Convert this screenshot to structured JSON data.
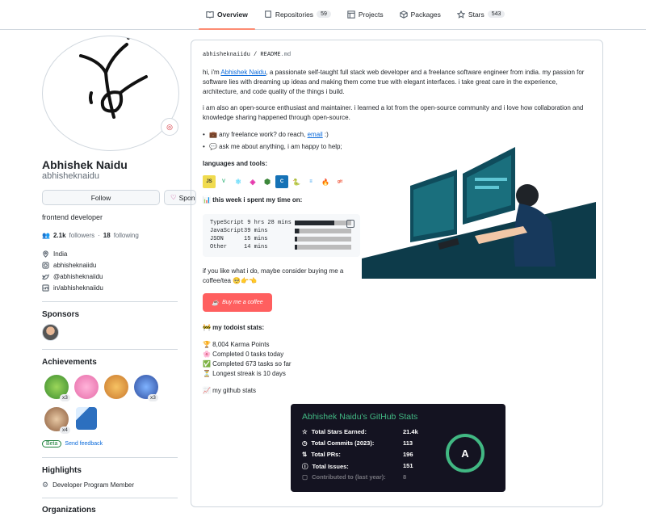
{
  "nav": {
    "tabs": [
      {
        "label": "Overview",
        "icon": "book-icon"
      },
      {
        "label": "Repositories",
        "icon": "repo-icon",
        "count": "59"
      },
      {
        "label": "Projects",
        "icon": "table-icon"
      },
      {
        "label": "Packages",
        "icon": "package-icon"
      },
      {
        "label": "Stars",
        "icon": "star-icon",
        "count": "543"
      }
    ]
  },
  "profile": {
    "name": "Abhishek Naidu",
    "login": "abhisheknaidu",
    "follow_label": "Follow",
    "sponsor_label": "Sponsor",
    "bio": "frontend developer",
    "followers_count": "2.1k",
    "followers_label": "followers",
    "following_count": "18",
    "following_label": "following",
    "location": "India",
    "instagram": "abhisheknaiidu",
    "twitter": "@abhisheknaiidu",
    "linkedin": "in/abhisheknaiidu"
  },
  "sidebar": {
    "sponsors_heading": "Sponsors",
    "achievements_heading": "Achievements",
    "achievements": [
      {
        "name": "pair-extraordinaire",
        "count": "x3"
      },
      {
        "name": "yolo",
        "count": ""
      },
      {
        "name": "starstruck",
        "count": ""
      },
      {
        "name": "pull-shark",
        "count": "x3"
      },
      {
        "name": "galaxy-brain",
        "count": "x4"
      },
      {
        "name": "arctic-code-vault",
        "count": ""
      }
    ],
    "beta_label": "Beta",
    "feedback_label": "Send feedback",
    "highlights_heading": "Highlights",
    "highlight_item": "Developer Program Member",
    "organizations_heading": "Organizations"
  },
  "readme": {
    "path_user": "abhisheknaiidu",
    "path_sep": "/",
    "path_file": "README",
    "path_ext": ".md",
    "intro_prefix": "hi, i'm ",
    "intro_link": "Abhishek Naidu",
    "intro_suffix": ", a passionate self-taught full stack web developer and a freelance software engineer from india. my passion for software lies with dreaming up ideas and making them come true with elegant interfaces. i take great care in the experience, architecture, and code quality of the things i build.",
    "para2": "i am also an open-source enthusiast and maintainer. i learned a lot from the open-source community and i love how collaboration and knowledge sharing happened through open-source.",
    "bullet1_prefix": "💼 any freelance work? do reach, ",
    "bullet1_link": "email",
    "bullet1_suffix": " :)",
    "bullet2": "💬 ask me about anything, i am happy to help;",
    "languages_heading": "languages and tools:",
    "tools": [
      "JS",
      "V",
      "⚛",
      "◈",
      "⬢",
      "C",
      "🐍",
      "≡",
      "🔥",
      "git"
    ],
    "week_heading": "📊 this week i spent my time on:",
    "time_rows": [
      {
        "lang": "TypeScript",
        "time": " 9 hrs 28 mins",
        "pct": 70
      },
      {
        "lang": "JavaScript",
        "time": "39 mins       ",
        "pct": 8
      },
      {
        "lang": "JSON      ",
        "time": "15 mins       ",
        "pct": 4
      },
      {
        "lang": "Other     ",
        "time": "14 mins       ",
        "pct": 4
      }
    ],
    "coffee_text": "if you like what i do, maybe consider buying me a coffee/tea 🥺👉👈",
    "coffee_button": "Buy me a coffee",
    "todoist_heading": "🚧 my todoist stats:",
    "todoist": [
      "🏆 8,004 Karma Points",
      "🌸 Completed 0 tasks today",
      "✅ Completed 673 tasks so far",
      "⏳ Longest streak is 10 days"
    ],
    "github_stats_heading": "📈 my github stats",
    "stats_card": {
      "title": "Abhishek Naidu's GitHub Stats",
      "rows": [
        {
          "label": "Total Stars Earned:",
          "value": "21.4k"
        },
        {
          "label": "Total Commits (2023):",
          "value": "113"
        },
        {
          "label": "Total PRs:",
          "value": "196"
        },
        {
          "label": "Total Issues:",
          "value": "151"
        },
        {
          "label": "Contributed to (last year):",
          "value": "8"
        }
      ],
      "grade": "A",
      "accent": "#41b883"
    }
  }
}
